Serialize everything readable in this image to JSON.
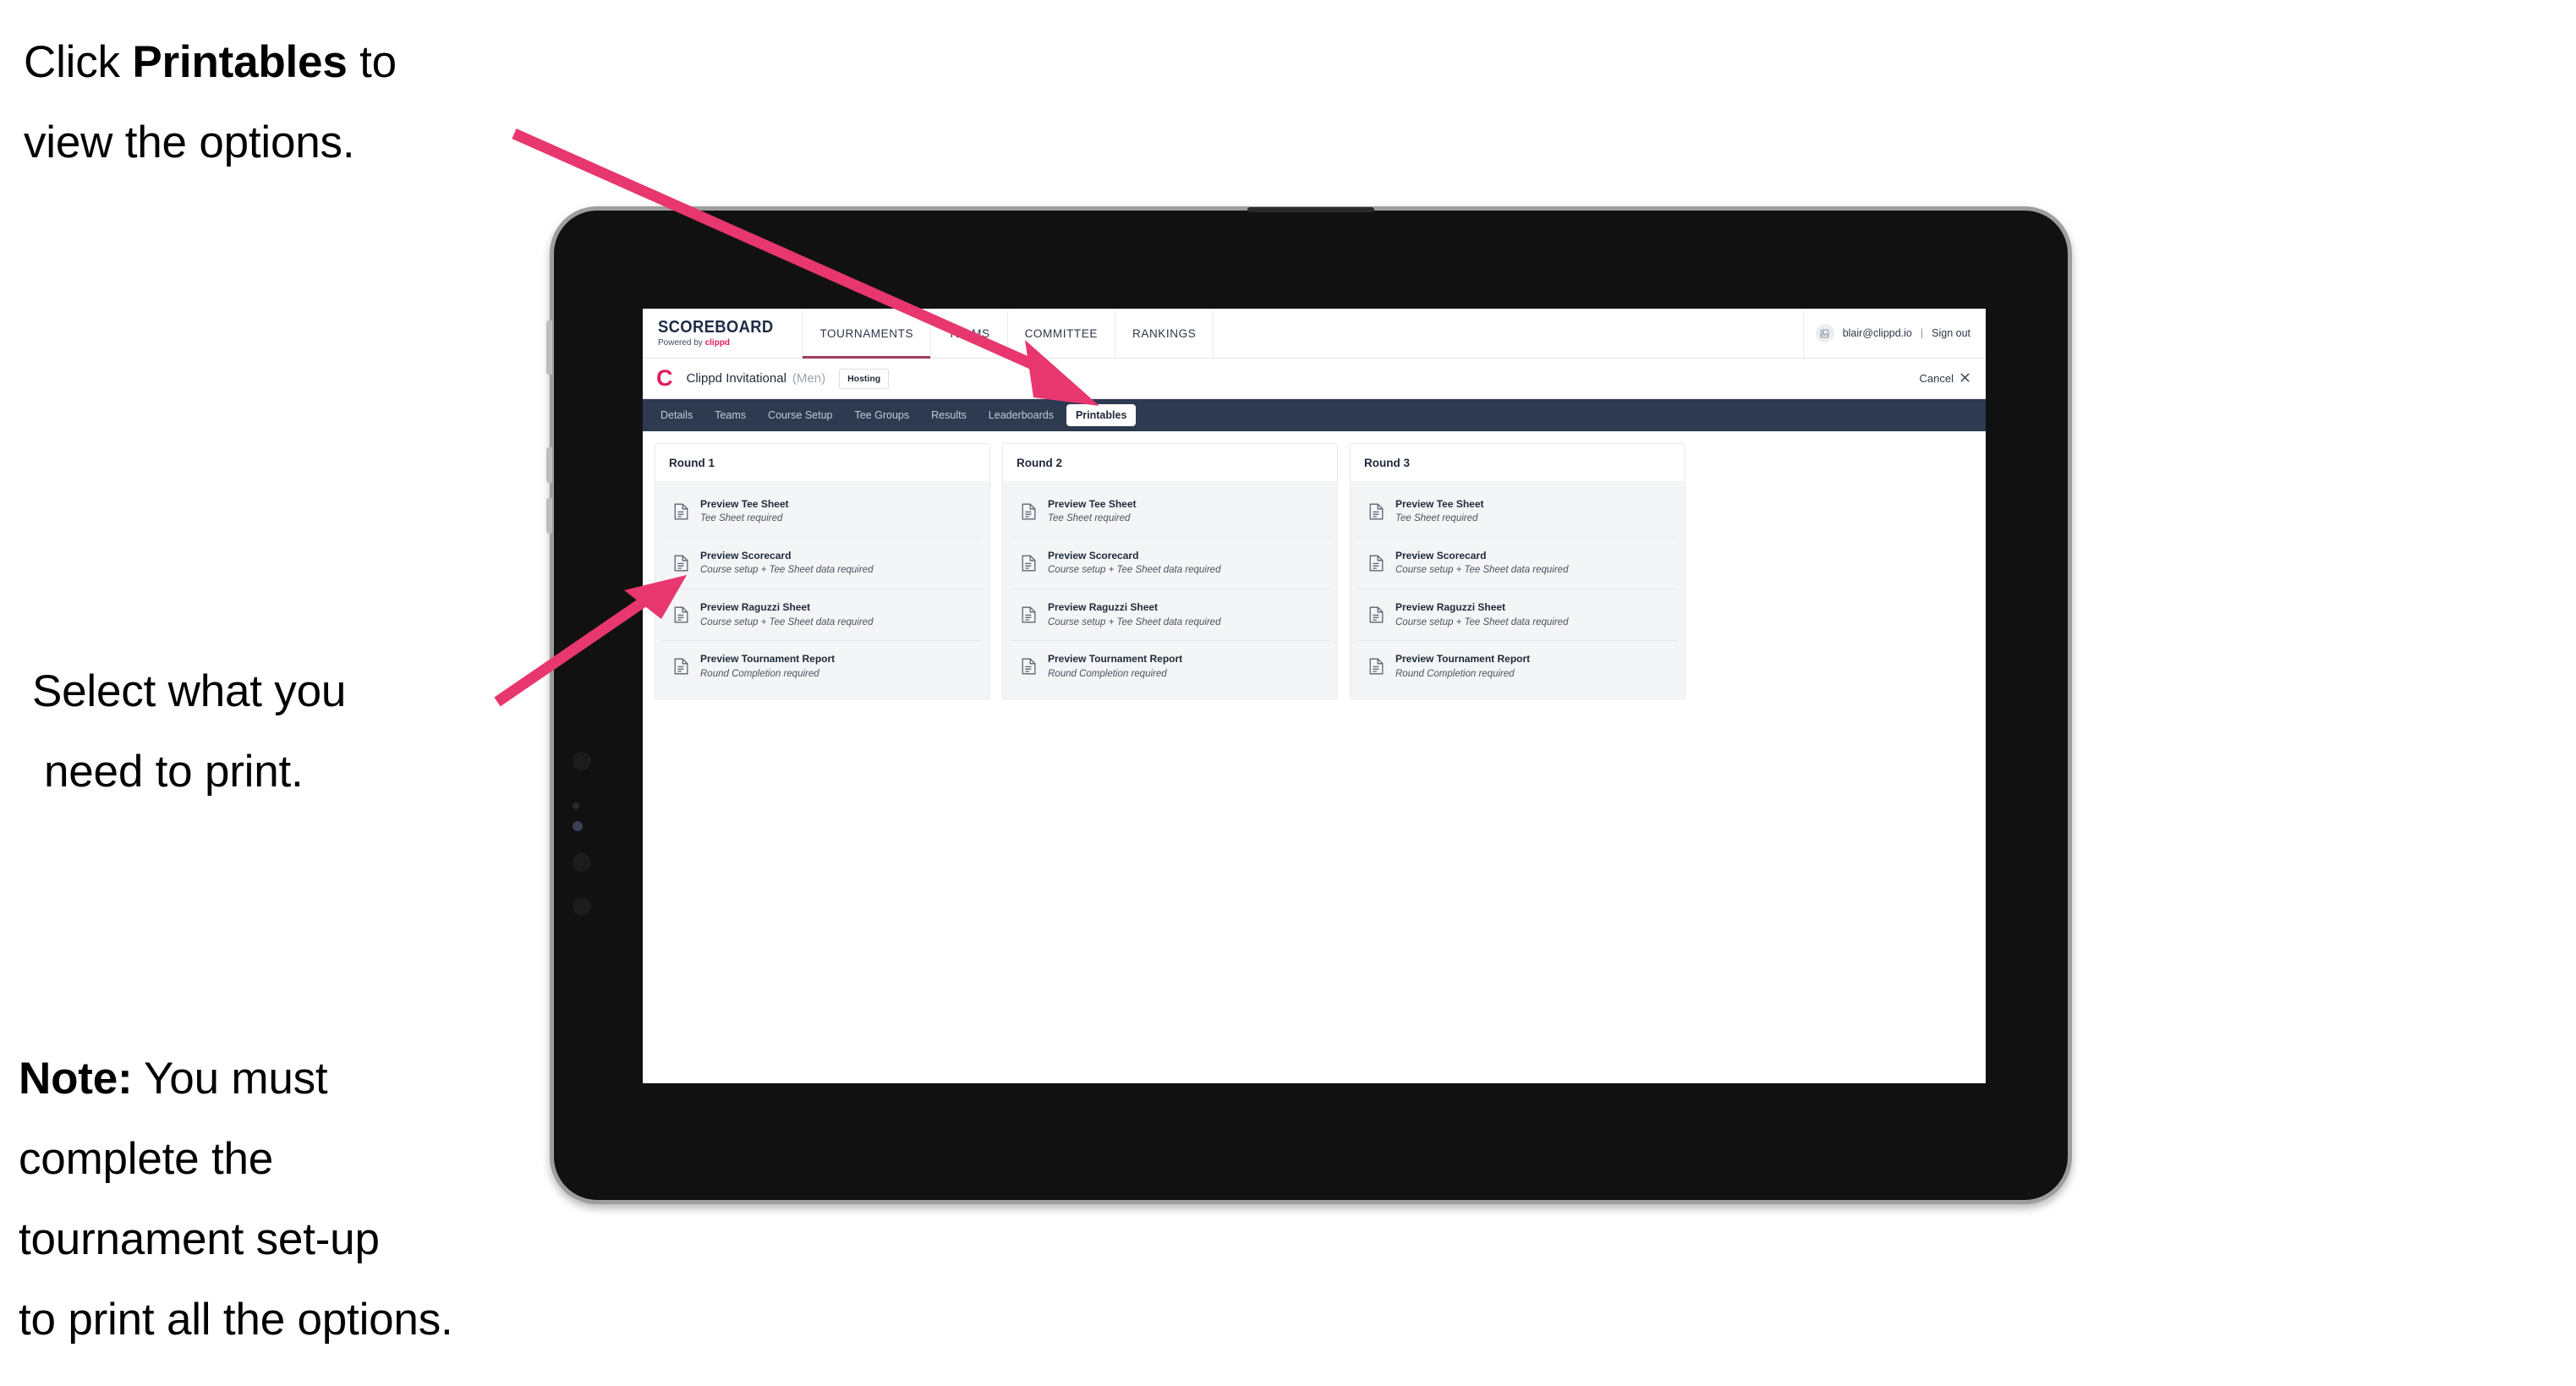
{
  "annotations": {
    "a1_line1_pre": "Click ",
    "a1_bold": "Printables",
    "a1_line1_post": " to",
    "a1_line2": "view the options.",
    "a2_line1": "Select what you",
    "a2_line2": "need to print.",
    "a3_bold": "Note:",
    "a3_line1_rest": " You must",
    "a3_line2": "complete the",
    "a3_line3": "tournament set-up",
    "a3_line4": "to print all the options."
  },
  "app": {
    "brand": {
      "main": "SCOREBOARD",
      "sub_pre": "Powered by ",
      "sub_brand": "clippd"
    },
    "topnav": [
      {
        "label": "TOURNAMENTS",
        "active": true
      },
      {
        "label": "TEAMS",
        "active": false
      },
      {
        "label": "COMMITTEE",
        "active": false
      },
      {
        "label": "RANKINGS",
        "active": false
      }
    ],
    "user": {
      "email": "blair@clippd.io",
      "separator": "|",
      "signout": "Sign out",
      "avatar_icon": "user-avatar-icon"
    },
    "tournament": {
      "logo_letter": "C",
      "name": "Clippd Invitational",
      "gender": "(Men)",
      "badge": "Hosting",
      "cancel": "Cancel",
      "cancel_icon": "close-icon"
    },
    "tabs": [
      {
        "label": "Details",
        "active": false
      },
      {
        "label": "Teams",
        "active": false
      },
      {
        "label": "Course Setup",
        "active": false
      },
      {
        "label": "Tee Groups",
        "active": false
      },
      {
        "label": "Results",
        "active": false
      },
      {
        "label": "Leaderboards",
        "active": false
      },
      {
        "label": "Printables",
        "active": true
      }
    ],
    "rounds": [
      {
        "title": "Round 1",
        "items": [
          {
            "title": "Preview Tee Sheet",
            "sub": "Tee Sheet required"
          },
          {
            "title": "Preview Scorecard",
            "sub": "Course setup + Tee Sheet data required"
          },
          {
            "title": "Preview Raguzzi Sheet",
            "sub": "Course setup + Tee Sheet data required"
          },
          {
            "title": "Preview Tournament Report",
            "sub": "Round Completion required"
          }
        ]
      },
      {
        "title": "Round 2",
        "items": [
          {
            "title": "Preview Tee Sheet",
            "sub": "Tee Sheet required"
          },
          {
            "title": "Preview Scorecard",
            "sub": "Course setup + Tee Sheet data required"
          },
          {
            "title": "Preview Raguzzi Sheet",
            "sub": "Course setup + Tee Sheet data required"
          },
          {
            "title": "Preview Tournament Report",
            "sub": "Round Completion required"
          }
        ]
      },
      {
        "title": "Round 3",
        "items": [
          {
            "title": "Preview Tee Sheet",
            "sub": "Tee Sheet required"
          },
          {
            "title": "Preview Scorecard",
            "sub": "Course setup + Tee Sheet data required"
          },
          {
            "title": "Preview Raguzzi Sheet",
            "sub": "Course setup + Tee Sheet data required"
          },
          {
            "title": "Preview Tournament Report",
            "sub": "Round Completion required"
          }
        ]
      }
    ]
  },
  "colors": {
    "accent_pink": "#e8366f",
    "brand_pink": "#e01b5c",
    "tabbar_navy": "#2e3a50",
    "nav_underline": "#a03c56",
    "panel_gray": "#f4f5f7"
  }
}
